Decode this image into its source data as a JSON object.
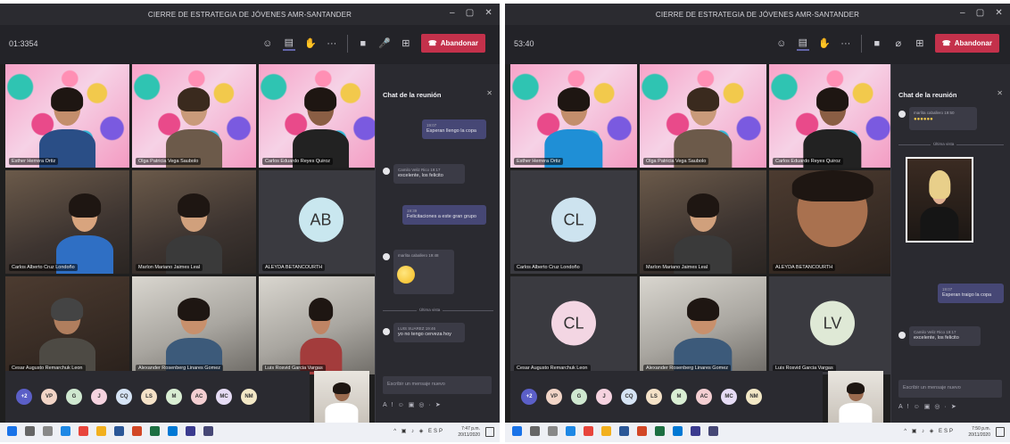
{
  "shot1": {
    "window_title": "CIERRE DE ESTRATEGIA DE JÓVENES AMR-SANTANDER",
    "timer": "01:3354",
    "leave_label": "Abandonar",
    "participants": [
      {
        "name": "Esther Herrera Ortiz"
      },
      {
        "name": "Olga Patricia Vega Saubolo"
      },
      {
        "name": "Carlos Eduardo Reyes Quiroz"
      },
      {
        "name": "Carlos Alberto Cruz Londoño"
      },
      {
        "name": "Marlon Mariano Jaimes Leal"
      },
      {
        "name": "ALEYDA BETANCOURTH",
        "initials": "AB"
      },
      {
        "name": "Cesar Augusto Remarchuk Leon"
      },
      {
        "name": "Alexander Rosenberg Linares Gomez"
      },
      {
        "name": "Luis Rosvid Garcia Vargas"
      }
    ],
    "overflow_avatars": [
      "+2",
      "VP",
      "G",
      "J",
      "CQ",
      "LS",
      "M",
      "AC",
      "MC",
      "NM"
    ],
    "chat": {
      "title": "Chat de la reunión",
      "messages": [
        {
          "meta": "19:07",
          "text": "Esperan llengo la copa"
        },
        {
          "meta": "Camilo Veliz Rico  19:17",
          "text": "excelente, los felicito"
        },
        {
          "meta": "19:39",
          "text": "Felicitaciones a este gran grupo"
        },
        {
          "meta": "marlita caballero  19:48",
          "text": ""
        },
        {
          "meta": "LUIS SUAREZ  19:46",
          "text": "yo no tengo cerveza hoy"
        }
      ],
      "divider_label": "Última vista",
      "compose_placeholder": "Escribir un mensaje nuevo"
    },
    "taskbar": {
      "time": "7:47 p.m.",
      "date": "20/11/2020"
    }
  },
  "shot2": {
    "window_title": "CIERRE DE ESTRATEGIA DE JÓVENES AMR-SANTANDER",
    "timer": "53:40",
    "leave_label": "Abandonar",
    "participants": [
      {
        "name": "Esther Herrera Ortiz"
      },
      {
        "name": "Olga Patricia Vega Saubolo"
      },
      {
        "name": "Carlos Eduardo Reyes Quiroz"
      },
      {
        "name": "Carlos Alberto Cruz Londoño",
        "initials": "CL"
      },
      {
        "name": "Marlon Mariano Jaimes Leal"
      },
      {
        "name": "ALEYDA BETANCOURTH"
      },
      {
        "name": "Cesar Augusto Remarchuk Leon",
        "initials": "CL"
      },
      {
        "name": "Alexander Rosenberg Linares Gomez"
      },
      {
        "name": "Luis Rosvid Garcia Vargas",
        "initials": "LV"
      }
    ],
    "overflow_avatars": [
      "+2",
      "VP",
      "G",
      "J",
      "CQ",
      "LS",
      "M",
      "AC",
      "MC",
      "NM"
    ],
    "chat": {
      "title": "Chat de la reunión",
      "messages": [
        {
          "meta": "marlita caballero  19:50",
          "text": ""
        },
        {
          "meta": "19:07",
          "text": "Esperan traigo la copa"
        },
        {
          "meta": "Camilo Veliz Rico  19:17",
          "text": "excelente, los felicito"
        }
      ],
      "divider_label": "Última vista",
      "compose_placeholder": "Escribir un mensaje nuevo"
    },
    "taskbar": {
      "time": "7:50 p.m.",
      "date": "20/11/2020"
    }
  },
  "colors": {
    "leave": "#c4314b",
    "accent": "#6264a7",
    "chat_bg": "#2a2a30",
    "stage_bg": "#1f1f1f"
  },
  "icons": [
    "minimize-icon",
    "maximize-icon",
    "close-icon",
    "hand-raise-icon",
    "chat-icon",
    "people-icon",
    "more-icon",
    "camera-icon",
    "mic-icon",
    "share-icon",
    "phone-icon",
    "send-icon",
    "mic-off-icon"
  ]
}
